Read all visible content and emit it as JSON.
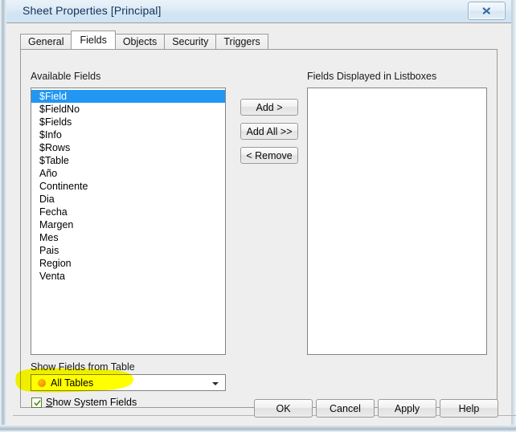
{
  "window": {
    "title": "Sheet Properties [Principal]",
    "close_icon": "close-x-icon"
  },
  "tabs": [
    {
      "label": "General",
      "active": false
    },
    {
      "label": "Fields",
      "active": true
    },
    {
      "label": "Objects",
      "active": false
    },
    {
      "label": "Security",
      "active": false
    },
    {
      "label": "Triggers",
      "active": false
    }
  ],
  "fields_tab": {
    "available": {
      "label": "Available Fields",
      "items": [
        {
          "name": "$Field",
          "selected": true
        },
        {
          "name": "$FieldNo",
          "selected": false
        },
        {
          "name": "$Fields",
          "selected": false
        },
        {
          "name": "$Info",
          "selected": false
        },
        {
          "name": "$Rows",
          "selected": false
        },
        {
          "name": "$Table",
          "selected": false
        },
        {
          "name": "Año",
          "selected": false
        },
        {
          "name": "Continente",
          "selected": false
        },
        {
          "name": "Dia",
          "selected": false
        },
        {
          "name": "Fecha",
          "selected": false
        },
        {
          "name": "Margen",
          "selected": false
        },
        {
          "name": "Mes",
          "selected": false
        },
        {
          "name": "Pais",
          "selected": false
        },
        {
          "name": "Region",
          "selected": false
        },
        {
          "name": "Venta",
          "selected": false
        }
      ]
    },
    "transfer_buttons": {
      "add": "Add >",
      "add_all": "Add All >>",
      "remove": "< Remove"
    },
    "displayed": {
      "label": "Fields Displayed in Listboxes",
      "items": []
    },
    "show_fields_from_table": {
      "label": "Show Fields from Table",
      "selected_value": "All Tables",
      "icon": "orange-circle-icon",
      "icon_color": "#f59a0c",
      "arrow_icon": "chevron-down-icon"
    },
    "show_system_fields": {
      "label": "Show System Fields",
      "accelerator": "S",
      "checked": true,
      "check_color": "#4e8a16"
    }
  },
  "dialog_buttons": {
    "ok": "OK",
    "cancel": "Cancel",
    "apply": "Apply",
    "help": "Help"
  },
  "annotation": {
    "type": "highlighter-blob",
    "color": "#ffff00",
    "targets": "show-system-fields-checkbox"
  },
  "colors": {
    "selection_blue": "#2196f3",
    "title_blue": "#13325b",
    "dialog_face": "#efeeee",
    "highlight_yellow": "#ffff00"
  }
}
